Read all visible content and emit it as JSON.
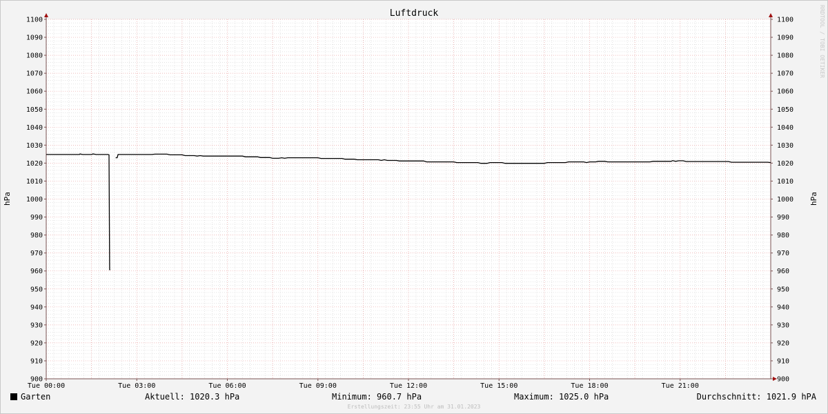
{
  "chart_data": {
    "type": "line",
    "title": "Luftdruck",
    "ylabel": "hPa",
    "ylabel_right": "hPa",
    "watermark": "RRDTOOL / TOBI OETIKER",
    "ylim": [
      900,
      1100
    ],
    "yticks": [
      900,
      910,
      920,
      930,
      940,
      950,
      960,
      970,
      980,
      990,
      1000,
      1010,
      1020,
      1030,
      1040,
      1050,
      1060,
      1070,
      1080,
      1090,
      1100
    ],
    "xlim": [
      0,
      24
    ],
    "xticks": [
      {
        "x": 0,
        "label": "Tue 00:00"
      },
      {
        "x": 3,
        "label": "Tue 03:00"
      },
      {
        "x": 6,
        "label": "Tue 06:00"
      },
      {
        "x": 9,
        "label": "Tue 09:00"
      },
      {
        "x": 12,
        "label": "Tue 12:00"
      },
      {
        "x": 15,
        "label": "Tue 15:00"
      },
      {
        "x": 18,
        "label": "Tue 18:00"
      },
      {
        "x": 21,
        "label": "Tue 21:00"
      }
    ],
    "grid": true,
    "colors": {
      "line": "#000000",
      "major_grid": "#e9a0a0",
      "minor_grid": "#d2d2d2",
      "axis": "#7a5050",
      "arrow": "#a01010"
    },
    "series": [
      {
        "name": "Garten",
        "color": "#000000",
        "points": [
          [
            0.0,
            1024.8
          ],
          [
            1.1,
            1024.8
          ],
          [
            1.12,
            1025.1
          ],
          [
            1.2,
            1024.8
          ],
          [
            1.5,
            1024.8
          ],
          [
            1.55,
            1025.1
          ],
          [
            1.65,
            1024.8
          ],
          [
            2.05,
            1024.8
          ],
          [
            2.08,
            1024.6
          ],
          [
            2.1,
            960.7
          ],
          [
            2.12,
            960.7
          ],
          [
            2.3,
            null
          ],
          [
            2.3,
            1023.0
          ],
          [
            2.35,
            1023.0
          ],
          [
            2.38,
            1024.8
          ],
          [
            3.5,
            1024.8
          ],
          [
            3.6,
            1025.0
          ],
          [
            4.0,
            1025.0
          ],
          [
            4.1,
            1024.6
          ],
          [
            4.5,
            1024.6
          ],
          [
            4.6,
            1024.2
          ],
          [
            4.9,
            1024.2
          ],
          [
            5.0,
            1023.9
          ],
          [
            5.1,
            1024.2
          ],
          [
            5.2,
            1023.9
          ],
          [
            6.5,
            1023.9
          ],
          [
            6.6,
            1023.5
          ],
          [
            7.0,
            1023.5
          ],
          [
            7.1,
            1023.1
          ],
          [
            7.4,
            1023.1
          ],
          [
            7.5,
            1022.7
          ],
          [
            7.7,
            1022.7
          ],
          [
            7.8,
            1023.0
          ],
          [
            7.9,
            1022.7
          ],
          [
            8.0,
            1023.0
          ],
          [
            9.0,
            1023.0
          ],
          [
            9.1,
            1022.6
          ],
          [
            9.8,
            1022.6
          ],
          [
            9.9,
            1022.2
          ],
          [
            10.2,
            1022.2
          ],
          [
            10.3,
            1021.9
          ],
          [
            11.0,
            1021.9
          ],
          [
            11.1,
            1021.5
          ],
          [
            11.2,
            1021.9
          ],
          [
            11.3,
            1021.5
          ],
          [
            11.6,
            1021.5
          ],
          [
            11.7,
            1021.2
          ],
          [
            12.5,
            1021.2
          ],
          [
            12.6,
            1020.7
          ],
          [
            13.5,
            1020.7
          ],
          [
            13.6,
            1020.3
          ],
          [
            14.3,
            1020.3
          ],
          [
            14.4,
            1019.9
          ],
          [
            14.6,
            1019.9
          ],
          [
            14.7,
            1020.3
          ],
          [
            15.1,
            1020.3
          ],
          [
            15.2,
            1019.9
          ],
          [
            16.5,
            1019.9
          ],
          [
            16.6,
            1020.3
          ],
          [
            17.2,
            1020.3
          ],
          [
            17.3,
            1020.7
          ],
          [
            17.8,
            1020.7
          ],
          [
            17.9,
            1020.3
          ],
          [
            18.0,
            1020.7
          ],
          [
            18.2,
            1020.7
          ],
          [
            18.3,
            1021.0
          ],
          [
            18.5,
            1021.0
          ],
          [
            18.6,
            1020.7
          ],
          [
            20.0,
            1020.7
          ],
          [
            20.1,
            1021.0
          ],
          [
            20.7,
            1021.0
          ],
          [
            20.75,
            1021.4
          ],
          [
            20.85,
            1021.0
          ],
          [
            20.95,
            1021.3
          ],
          [
            21.1,
            1021.3
          ],
          [
            21.2,
            1020.9
          ],
          [
            22.6,
            1020.9
          ],
          [
            22.7,
            1020.5
          ],
          [
            23.9,
            1020.5
          ],
          [
            24.0,
            1020.3
          ]
        ]
      }
    ]
  },
  "legend": {
    "series_name": "Garten",
    "current": "Aktuell: 1020.3 hPa",
    "minimum": "Minimum: 960.7 hPa",
    "maximum": "Maximum: 1025.0 hPa",
    "average": "Durchschnitt: 1021.9 hPA"
  },
  "footer": "Erstellungszeit: 23:55 Uhr am 31.01.2023"
}
